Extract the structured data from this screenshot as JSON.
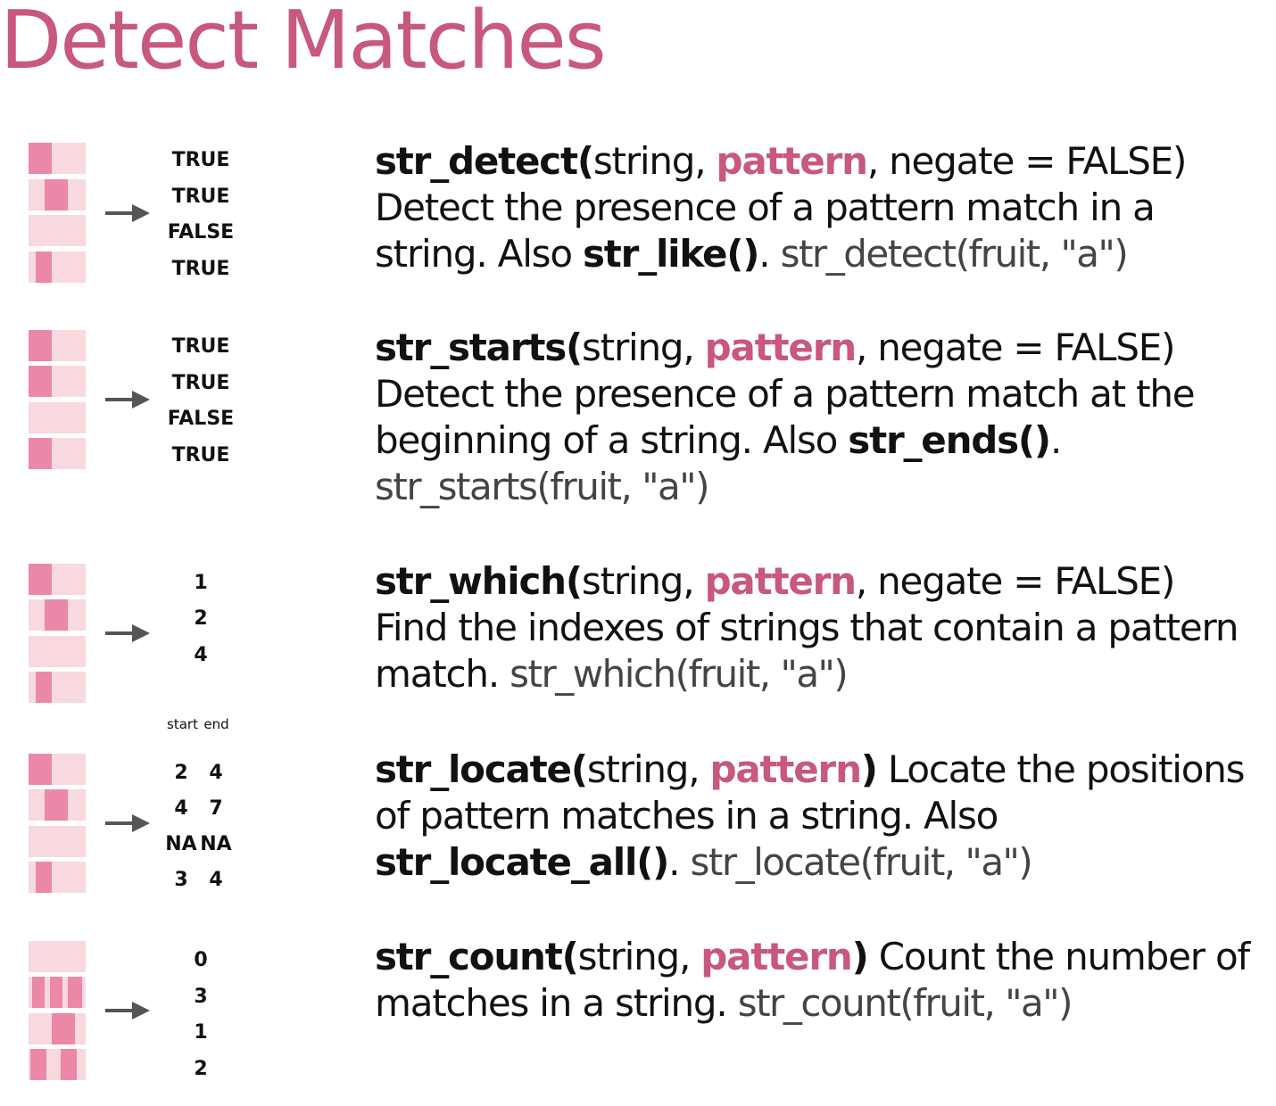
{
  "title": "Detect Matches",
  "colors": {
    "accent": "#c8587d",
    "string_bg": "#f8d9dd",
    "match": "#ec88a7",
    "arrow": "#555555"
  },
  "sections": [
    {
      "outputs": [
        "TRUE",
        "TRUE",
        "FALSE",
        "TRUE"
      ],
      "fn": "str_detect(",
      "args_pre": "string, ",
      "pattern": "pattern",
      "args_post": ", negate = FALSE)",
      "desc": "Detect the presence of a pattern match in a string. Also ",
      "also_fn": "str_like()",
      "dot": ". ",
      "example": "str_detect(fruit, \"a\")"
    },
    {
      "outputs": [
        "TRUE",
        "TRUE",
        "FALSE",
        "TRUE"
      ],
      "fn": "str_starts(",
      "args_pre": "string, ",
      "pattern": "pattern",
      "args_post": ", negate = FALSE)",
      "desc": "Detect the presence of a pattern match at the beginning of a string. Also ",
      "also_fn": "str_ends()",
      "dot": ".",
      "example": "str_starts(fruit, \"a\")"
    },
    {
      "outputs": [
        "1",
        "2",
        "4"
      ],
      "fn": "str_which(",
      "args_pre": "string, ",
      "pattern": "pattern",
      "args_post": ", negate = FALSE)",
      "desc": "Find the indexes of strings that contain a pattern match. ",
      "example": "str_which(fruit, \"a\")"
    },
    {
      "header": [
        "start",
        "end"
      ],
      "pairs": [
        [
          "2",
          "4"
        ],
        [
          "4",
          "7"
        ],
        [
          "NA",
          "NA"
        ],
        [
          "3",
          "4"
        ]
      ],
      "fn": "str_locate(",
      "args_pre": "string, ",
      "pattern": "pattern",
      "args_post": ")",
      "desc": " Locate the positions of pattern matches in a string. Also ",
      "also_fn": "str_locate_all()",
      "dot": ". ",
      "example": "str_locate(fruit, \"a\")"
    },
    {
      "outputs": [
        "0",
        "3",
        "1",
        "2"
      ],
      "fn": "str_count(",
      "args_pre": "string, ",
      "pattern": "pattern",
      "args_post": ")",
      "desc": " Count the number of matches in a string. ",
      "example": "str_count(fruit, \"a\")"
    }
  ]
}
